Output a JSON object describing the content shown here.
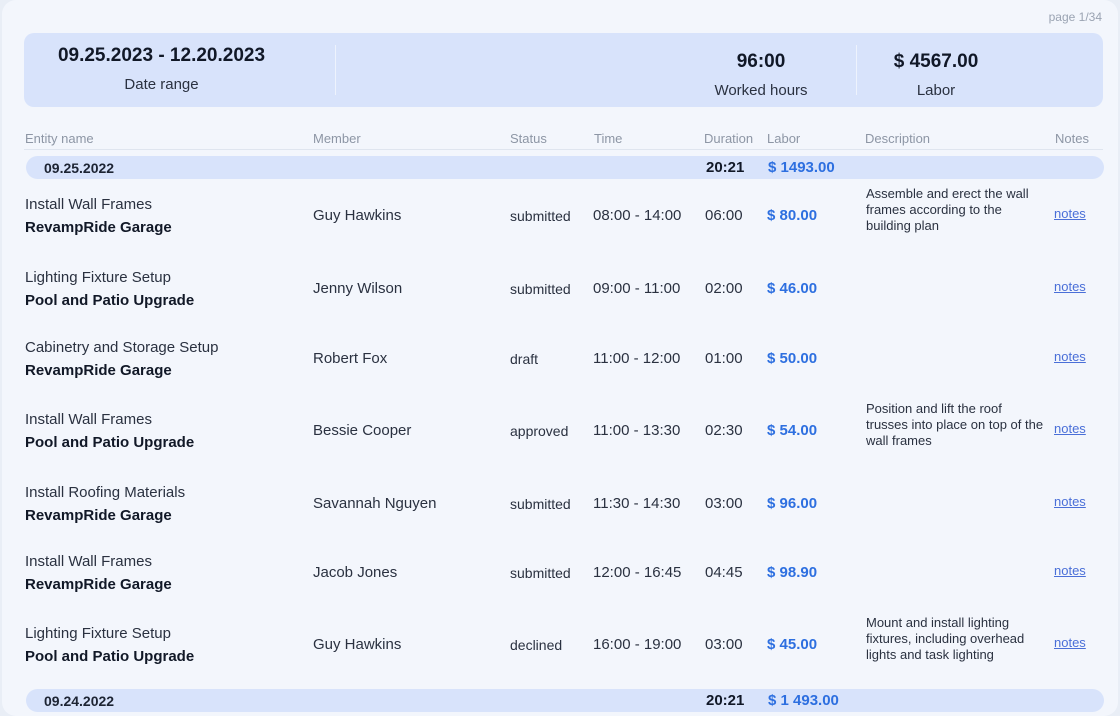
{
  "page_label": "page 1/34",
  "summary": {
    "date_range_value": "09.25.2023 - 12.20.2023",
    "date_range_label": "Date range",
    "hours_value": "96:00",
    "hours_label": "Worked hours",
    "labor_value": "$ 4567.00",
    "labor_label": "Labor"
  },
  "columns": {
    "entity": "Entity name",
    "member": "Member",
    "status": "Status",
    "time": "Time",
    "duration": "Duration",
    "labor": "Labor",
    "description": "Description",
    "notes": "Notes"
  },
  "groups": [
    {
      "date": "09.25.2022",
      "duration": "20:21",
      "labor": "$  1493.00"
    },
    {
      "date": "09.24.2022",
      "duration": "20:21",
      "labor": "$ 1 493.00"
    }
  ],
  "rows": [
    {
      "task": "Install Wall Frames",
      "project": "RevampRide Garage",
      "member": "Guy Hawkins",
      "status": "submitted",
      "time": "08:00 - 14:00",
      "duration": "06:00",
      "labor": "$ 80.00",
      "description": "Assemble and erect the wall frames according to the building plan",
      "notes": "notes"
    },
    {
      "task": "Lighting Fixture Setup",
      "project": "Pool and Patio Upgrade",
      "member": "Jenny Wilson",
      "status": "submitted",
      "time": "09:00 - 11:00",
      "duration": "02:00",
      "labor": "$ 46.00",
      "description": "",
      "notes": "notes"
    },
    {
      "task": "Cabinetry and Storage Setup",
      "project": "RevampRide Garage",
      "member": "Robert Fox",
      "status": "draft",
      "time": "11:00 - 12:00",
      "duration": "01:00",
      "labor": "$ 50.00",
      "description": "",
      "notes": "notes"
    },
    {
      "task": "Install Wall Frames",
      "project": "Pool and Patio Upgrade",
      "member": "Bessie Cooper",
      "status": "approved",
      "time": "11:00 - 13:30",
      "duration": "02:30",
      "labor": "$ 54.00",
      "description": "Position and lift the roof trusses into place on top of the wall frames",
      "notes": "notes"
    },
    {
      "task": "Install Roofing Materials",
      "project": "RevampRide Garage",
      "member": "Savannah Nguyen",
      "status": "submitted",
      "time": "11:30 - 14:30",
      "duration": "03:00",
      "labor": "$ 96.00",
      "description": "",
      "notes": "notes"
    },
    {
      "task": "Install Wall Frames",
      "project": "RevampRide Garage",
      "member": "Jacob Jones",
      "status": "submitted",
      "time": "12:00 - 16:45",
      "duration": "04:45",
      "labor": "$ 98.90",
      "description": "",
      "notes": "notes"
    },
    {
      "task": "Lighting Fixture Setup",
      "project": "Pool and Patio Upgrade",
      "member": "Guy Hawkins",
      "status": "declined",
      "time": "16:00 - 19:00",
      "duration": "03:00",
      "labor": "$ 45.00",
      "description": "Mount and install lighting fixtures, including overhead lights and task lighting",
      "notes": "notes"
    }
  ]
}
